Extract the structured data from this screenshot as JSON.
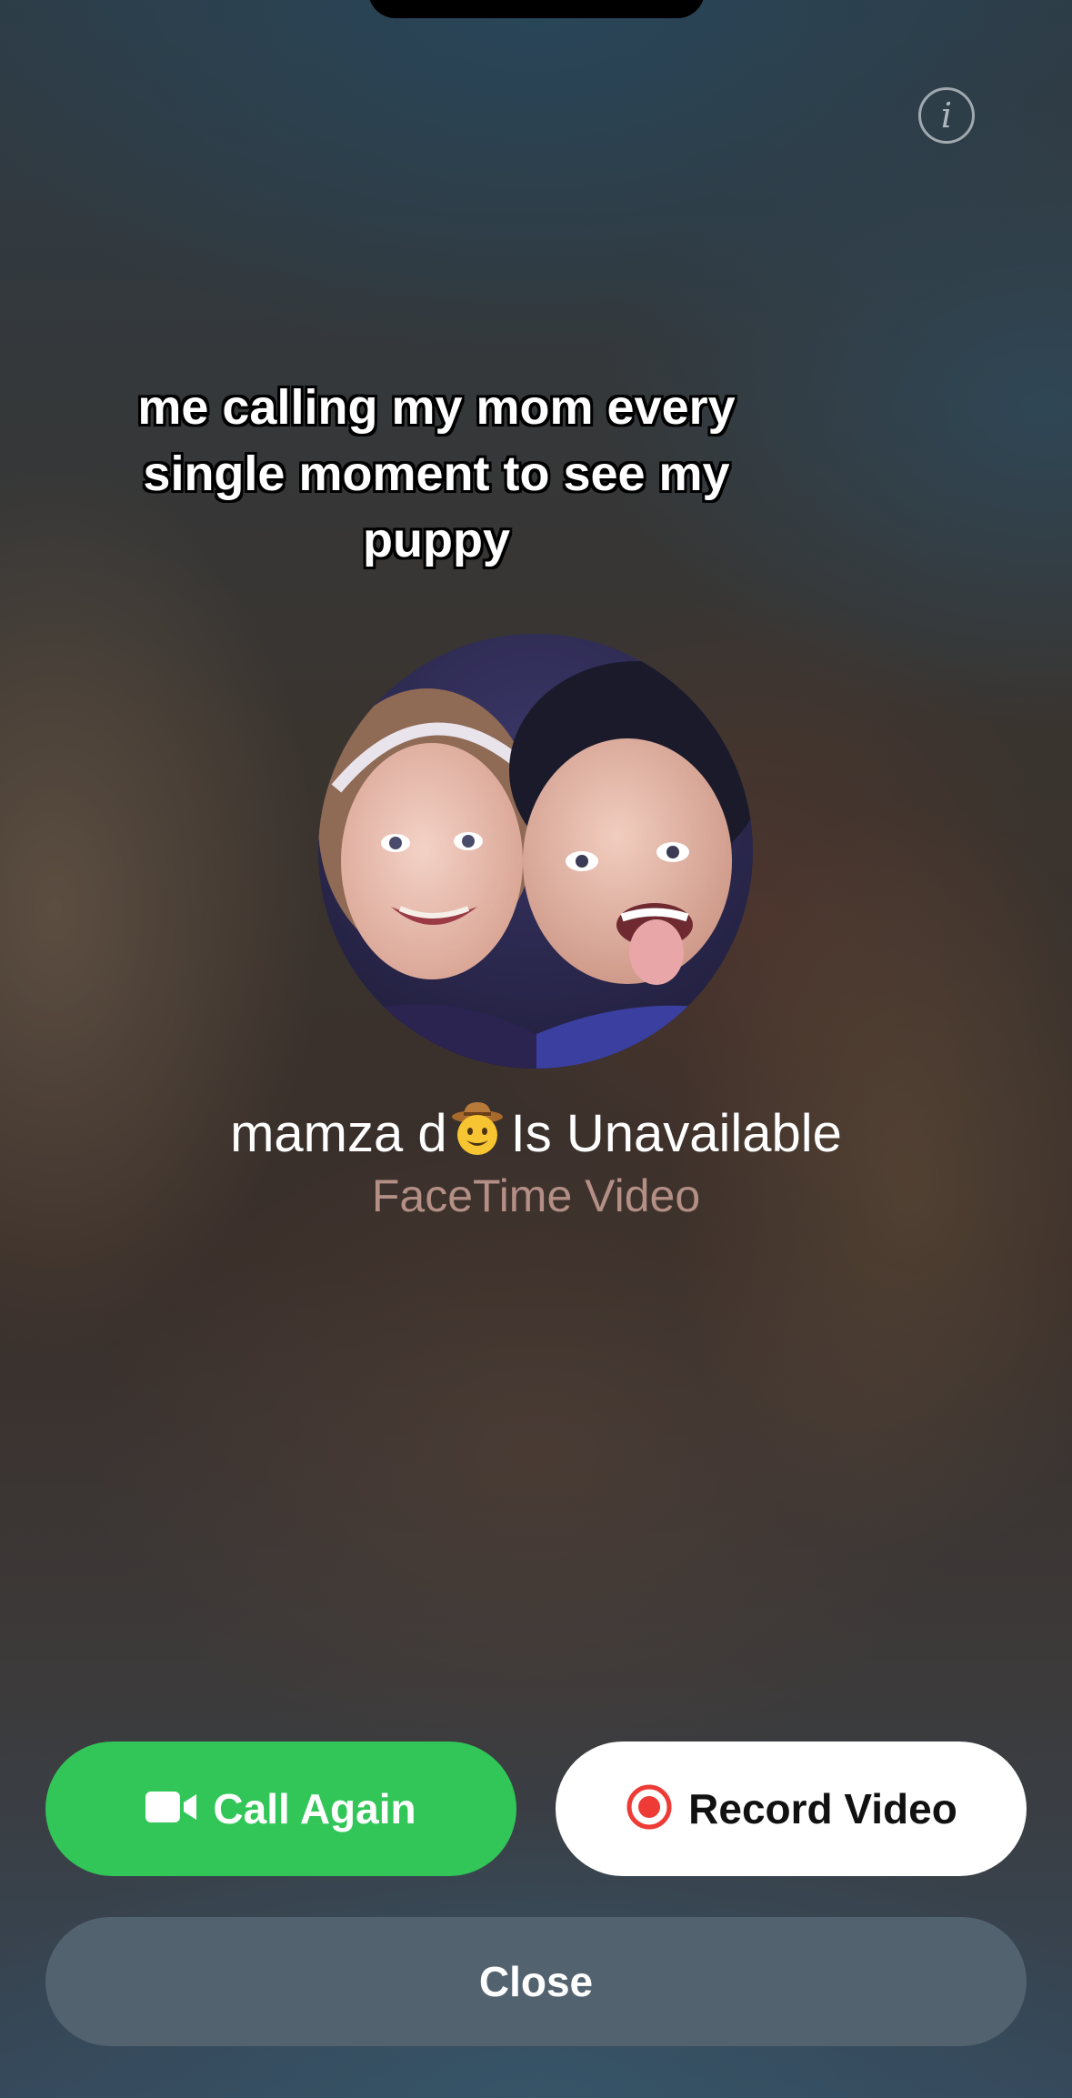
{
  "caption": {
    "line1": "me calling my mom every",
    "line2": "single moment to see my",
    "line3": "puppy"
  },
  "caller": {
    "name": "mamza d",
    "emoji": "cowboy-hat-face",
    "status": "Is Unavailable",
    "call_type": "FaceTime Video"
  },
  "actions": {
    "call_again": "Call Again",
    "record_video": "Record Video",
    "close": "Close"
  },
  "icons": {
    "info": "info-circle-icon",
    "video_camera": "video-camera-icon",
    "record": "record-icon"
  },
  "colors": {
    "call_again_bg": "#32c659",
    "record_bg": "#ffffff",
    "record_icon": "#ef3b36",
    "close_bg": "#52626f",
    "call_type_text": "#b38f86"
  }
}
